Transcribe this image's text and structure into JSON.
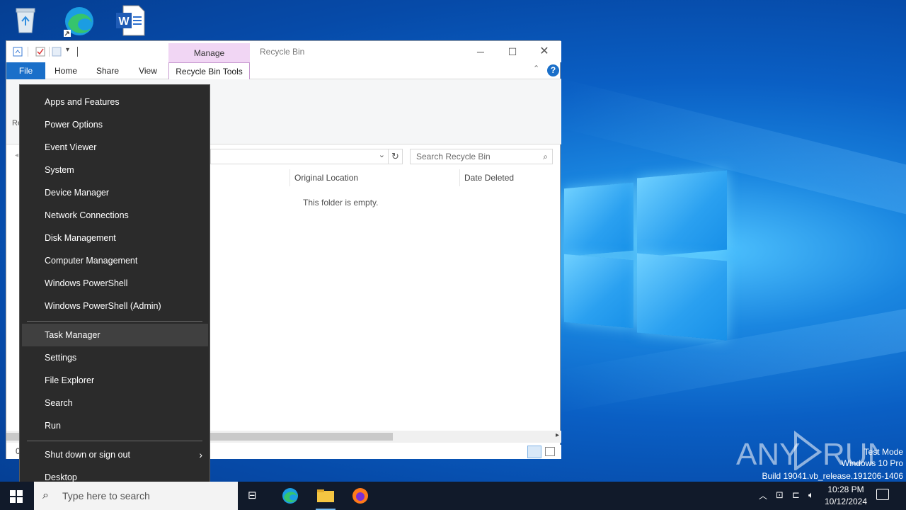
{
  "explorer": {
    "title": "Recycle Bin",
    "manage_label": "Manage",
    "tabs": {
      "file": "File",
      "home": "Home",
      "share": "Share",
      "view": "View",
      "rbt": "Recycle Bin Tools"
    },
    "search_placeholder": "Search Recycle Bin",
    "columns": {
      "original_location": "Original Location",
      "date_deleted": "Date Deleted"
    },
    "empty_message": "This folder is empty.",
    "status_fragment": "0",
    "ribbon_fragment": "Re"
  },
  "winx_menu": {
    "items_group1": [
      "Apps and Features",
      "Power Options",
      "Event Viewer",
      "System",
      "Device Manager",
      "Network Connections",
      "Disk Management",
      "Computer Management",
      "Windows PowerShell",
      "Windows PowerShell (Admin)"
    ],
    "items_group2": [
      "Task Manager",
      "Settings",
      "File Explorer",
      "Search",
      "Run"
    ],
    "items_group3": [
      "Shut down or sign out",
      "Desktop"
    ],
    "selected_item": "Task Manager"
  },
  "taskbar": {
    "search_placeholder": "Type here to search",
    "time": "10:28 PM",
    "date": "10/12/2024"
  },
  "watermark": {
    "brand": "ANY RUN",
    "line1": "Test Mode",
    "line2": "Windows 10 Pro",
    "line3": "Build 19041.vb_release.191206-1406"
  }
}
